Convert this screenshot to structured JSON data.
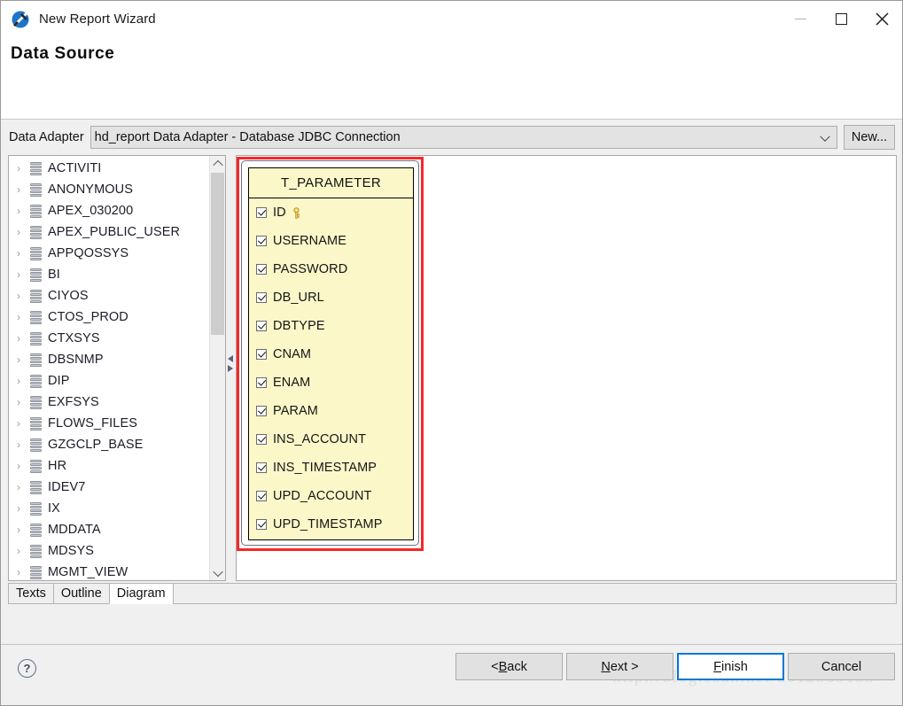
{
  "window": {
    "title": "New Report Wizard",
    "icon": "jasper-logo-icon",
    "controls": {
      "minimize": "minimize-icon",
      "maximize": "maximize-icon",
      "close": "✕"
    }
  },
  "page": {
    "heading": "Data Source"
  },
  "adapter": {
    "label": "Data Adapter",
    "value": "hd_report Data Adapter  - Database JDBC Connection",
    "new_button": "New..."
  },
  "tree": {
    "items": [
      {
        "label": "ACTIVITI"
      },
      {
        "label": "ANONYMOUS"
      },
      {
        "label": "APEX_030200"
      },
      {
        "label": "APEX_PUBLIC_USER"
      },
      {
        "label": "APPQOSSYS"
      },
      {
        "label": "BI"
      },
      {
        "label": "CIYOS"
      },
      {
        "label": "CTOS_PROD"
      },
      {
        "label": "CTXSYS"
      },
      {
        "label": "DBSNMP"
      },
      {
        "label": "DIP"
      },
      {
        "label": "EXFSYS"
      },
      {
        "label": "FLOWS_FILES"
      },
      {
        "label": "GZGCLP_BASE"
      },
      {
        "label": "HR"
      },
      {
        "label": "IDEV7"
      },
      {
        "label": "IX"
      },
      {
        "label": "MDDATA"
      },
      {
        "label": "MDSYS"
      },
      {
        "label": "MGMT_VIEW"
      }
    ],
    "expand_arrow": "›"
  },
  "diagram": {
    "table": {
      "name": "T_PARAMETER",
      "fields": [
        {
          "name": "ID",
          "checked": true,
          "primary_key": true
        },
        {
          "name": "USERNAME",
          "checked": true,
          "primary_key": false
        },
        {
          "name": "PASSWORD",
          "checked": true,
          "primary_key": false
        },
        {
          "name": "DB_URL",
          "checked": true,
          "primary_key": false
        },
        {
          "name": "DBTYPE",
          "checked": true,
          "primary_key": false
        },
        {
          "name": "CNAM",
          "checked": true,
          "primary_key": false
        },
        {
          "name": "ENAM",
          "checked": true,
          "primary_key": false
        },
        {
          "name": "PARAM",
          "checked": true,
          "primary_key": false
        },
        {
          "name": "INS_ACCOUNT",
          "checked": true,
          "primary_key": false
        },
        {
          "name": "INS_TIMESTAMP",
          "checked": true,
          "primary_key": false
        },
        {
          "name": "UPD_ACCOUNT",
          "checked": true,
          "primary_key": false
        },
        {
          "name": "UPD_TIMESTAMP",
          "checked": true,
          "primary_key": false
        }
      ]
    },
    "highlight_color": "#f92626",
    "table_fill_color": "#fbf7c9"
  },
  "tabs": [
    {
      "label": "Texts",
      "active": false
    },
    {
      "label": "Outline",
      "active": false
    },
    {
      "label": "Diagram",
      "active": true
    }
  ],
  "footer": {
    "help": "?",
    "buttons": {
      "back_prefix": "< ",
      "back_mnemonic": "B",
      "back_suffix": "ack",
      "next_mnemonic": "N",
      "next_suffix": "ext >",
      "finish_mnemonic": "F",
      "finish_suffix": "inish",
      "cancel": "Cancel"
    },
    "accent_color": "#0078d7"
  },
  "watermark": "http://blog.csdn.net/u012369153"
}
